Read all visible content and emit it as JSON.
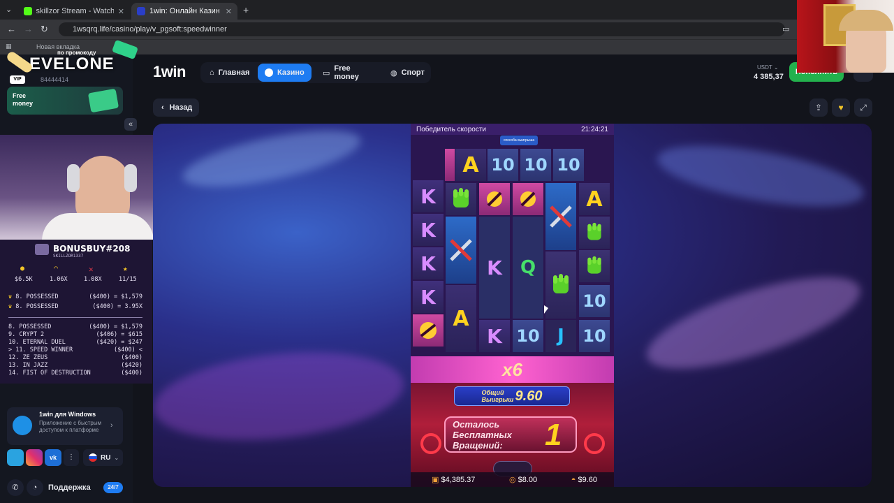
{
  "browser": {
    "tabs": [
      {
        "title": "skillzor Stream - Watch Live on",
        "active": false
      },
      {
        "title": "1win: Онлайн Казино и Сп",
        "active": true
      }
    ],
    "url": "1wsqrq.life/casino/play/v_pgsoft:speedwinner",
    "bookmark": "Новая вкладка"
  },
  "site": {
    "logo": "1win",
    "nav": [
      {
        "label": "Главная",
        "active": false
      },
      {
        "label": "Казино",
        "active": true
      },
      {
        "label": "Free money",
        "active": false
      },
      {
        "label": "Спорт",
        "active": false
      }
    ],
    "currency": "USDT",
    "balance": "4 385,37",
    "deposit_label": "Пополнить",
    "back_label": "Назад",
    "sidebar": {
      "promo_top": "по промокоду",
      "promo_code": "EVELONE",
      "vip_id": "84444414",
      "free_money": "Free money",
      "app_title": "1win для Windows",
      "app_desc": "Приложение с быстрым доступом к платформе",
      "lang": "RU",
      "support": "Поддержка",
      "support_badge": "24/7"
    }
  },
  "game": {
    "title": "Победитель скорости",
    "time": "21:24:21",
    "top_banner": "способа выигрыша",
    "multiplier": "x6",
    "total_win_label": "Общий Выигрыш",
    "total_win_value": "9.60",
    "free_spins_label": "Осталось Бесплатных Вращений:",
    "free_spins_value": "1",
    "balance": "$4,385.37",
    "bet": "$8.00",
    "win": "$9.60",
    "top_row": [
      "fire",
      "A",
      "10",
      "10",
      "10"
    ],
    "grid": [
      [
        "K",
        "K",
        "K",
        "K",
        "fire"
      ],
      [
        "glove",
        "tool",
        "A"
      ],
      [
        "fire",
        "K",
        "K"
      ],
      [
        "fire",
        "Q",
        "10"
      ],
      [
        "tool",
        "glove",
        "J"
      ],
      [
        "A",
        "glove",
        "glove",
        "10",
        "10"
      ]
    ]
  },
  "overlay": {
    "title": "BONUSBUY#208",
    "subtitle": "SKILLZOR1337",
    "stats": [
      "$6.5K",
      "1.06X",
      "1.08X",
      "11/15"
    ],
    "best": [
      {
        "left": "8. POSSESSED",
        "right": "($400) = $1,579"
      },
      {
        "left": "8. POSSESSED",
        "right": "($400) = 3.95X"
      }
    ],
    "list": [
      {
        "left": "8. POSSESSED",
        "right": "($400) = $1,579"
      },
      {
        "left": "9. CRYPT 2",
        "right": "($406) =   $615"
      },
      {
        "left": "10. ETERNAL DUEL",
        "right": "($420) =   $247"
      },
      {
        "left": " > 11. SPEED WINNER",
        "right": "($400) <"
      },
      {
        "left": "12. ZE ZEUS",
        "right": "($400)"
      },
      {
        "left": "13. IN JAZZ",
        "right": "($420)"
      },
      {
        "left": "14. FIST OF DESTRUCTION",
        "right": "($400)"
      }
    ]
  }
}
